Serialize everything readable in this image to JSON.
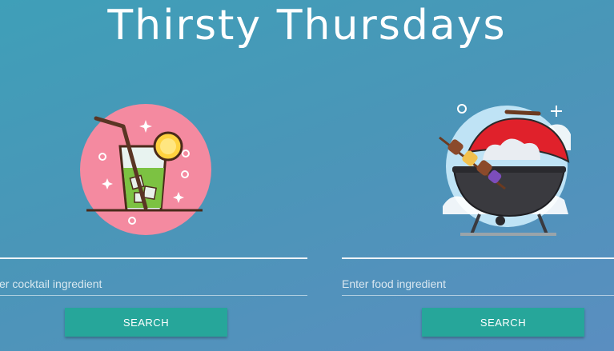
{
  "header": {
    "title": "Thirsty Thursdays"
  },
  "cocktail": {
    "icon": "cocktail-glass-icon",
    "placeholder": "Enter cocktail ingredient",
    "button_label": "SEARCH"
  },
  "food": {
    "icon": "barbecue-grill-icon",
    "placeholder": "Enter food ingredient",
    "button_label": "SEARCH"
  },
  "colors": {
    "accent": "#26a69a",
    "background_start": "#3f9fb8",
    "background_end": "#5a8ec0"
  }
}
